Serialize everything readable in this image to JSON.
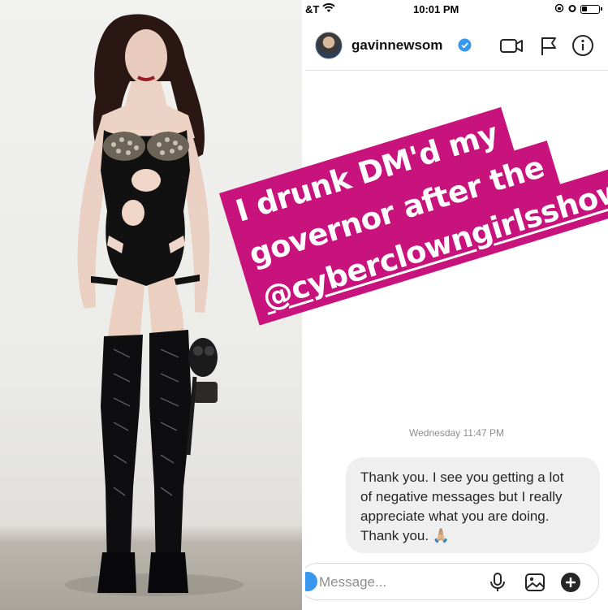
{
  "status_bar": {
    "carrier": "&T",
    "time": "10:01 PM",
    "battery_level": 0.35
  },
  "header": {
    "username": "gavinnewsom",
    "verified": true,
    "icons": [
      "video-call-icon",
      "flag-icon",
      "info-icon"
    ]
  },
  "caption": {
    "line1": "I drunk DM'd my",
    "line2": "governor after the",
    "line3": "@cyberclowngirlsshow",
    "color": "#c8127c"
  },
  "thread": {
    "timestamp": "Wednesday 11:47 PM",
    "message_lines": [
      "Thank you. I see you getting a lot",
      "of negative messages but I really",
      "appreciate what you are doing.",
      "Thank you. 🙏🏼"
    ]
  },
  "composer": {
    "placeholder": "Message...",
    "icons": [
      "microphone-icon",
      "gallery-icon",
      "add-icon"
    ]
  },
  "colors": {
    "accent_blue": "#3897f0",
    "bubble_bg": "#efefef",
    "timestamp_gray": "#8e8e8e"
  }
}
